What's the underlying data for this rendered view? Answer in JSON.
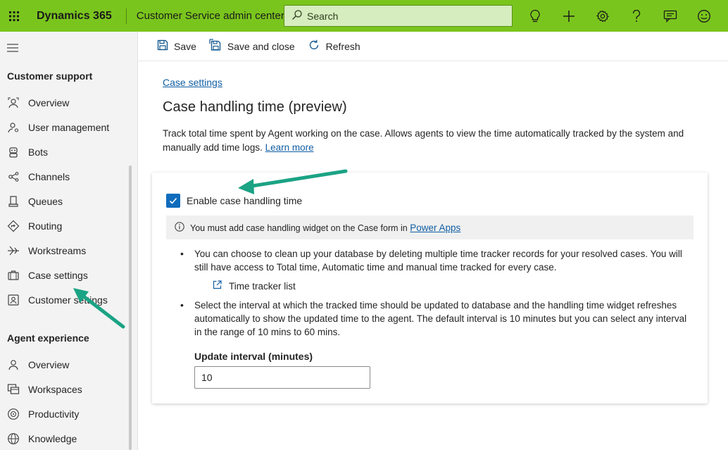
{
  "topbar": {
    "brand": "Dynamics 365",
    "app_title": "Customer Service admin center",
    "search_placeholder": "Search",
    "icons": [
      "lightbulb-icon",
      "plus-icon",
      "settings-icon",
      "help-icon",
      "feedback-icon",
      "smiley-icon"
    ],
    "accent_color": "#7ac51d"
  },
  "sidebar": {
    "sections": [
      {
        "title": "Customer support",
        "items": [
          {
            "label": "Overview",
            "icon": "overview-icon"
          },
          {
            "label": "User management",
            "icon": "user-management-icon"
          },
          {
            "label": "Bots",
            "icon": "bot-icon"
          },
          {
            "label": "Channels",
            "icon": "channels-icon"
          },
          {
            "label": "Queues",
            "icon": "queues-icon"
          },
          {
            "label": "Routing",
            "icon": "routing-icon"
          },
          {
            "label": "Workstreams",
            "icon": "workstreams-icon"
          },
          {
            "label": "Case settings",
            "icon": "case-settings-icon"
          },
          {
            "label": "Customer settings",
            "icon": "customer-settings-icon"
          }
        ]
      },
      {
        "title": "Agent experience",
        "items": [
          {
            "label": "Overview",
            "icon": "overview-icon"
          },
          {
            "label": "Workspaces",
            "icon": "workspaces-icon"
          },
          {
            "label": "Productivity",
            "icon": "productivity-icon"
          },
          {
            "label": "Knowledge",
            "icon": "knowledge-icon"
          }
        ]
      }
    ]
  },
  "commandbar": {
    "save": "Save",
    "save_and_close": "Save and close",
    "refresh": "Refresh"
  },
  "main": {
    "breadcrumb": "Case settings",
    "title": "Case handling time (preview)",
    "description": "Track total time spent by Agent working on the case. Allows agents to view the time automatically tracked by the system and manually add time logs.",
    "learn_more": "Learn more",
    "card": {
      "checkbox_label": "Enable case handling time",
      "checkbox_checked": true,
      "info_text": "You must add case handling widget on the Case form in",
      "info_link": "Power Apps",
      "bullet1": "You can choose to clean up your database by deleting multiple time tracker records for your resolved cases. You will still have access to Total time, Automatic time and manual time tracked for every case.",
      "tracker_link": "Time tracker list",
      "bullet2": "Select the interval at which the tracked time should be updated to database and the handling time widget refreshes automatically to show the updated time to the agent. The default interval is 10 minutes but you can select any interval in the range of 10 mins to 60 mins.",
      "interval_label": "Update interval (minutes)",
      "interval_value": "10"
    }
  },
  "annotation_color": "#1aa384"
}
